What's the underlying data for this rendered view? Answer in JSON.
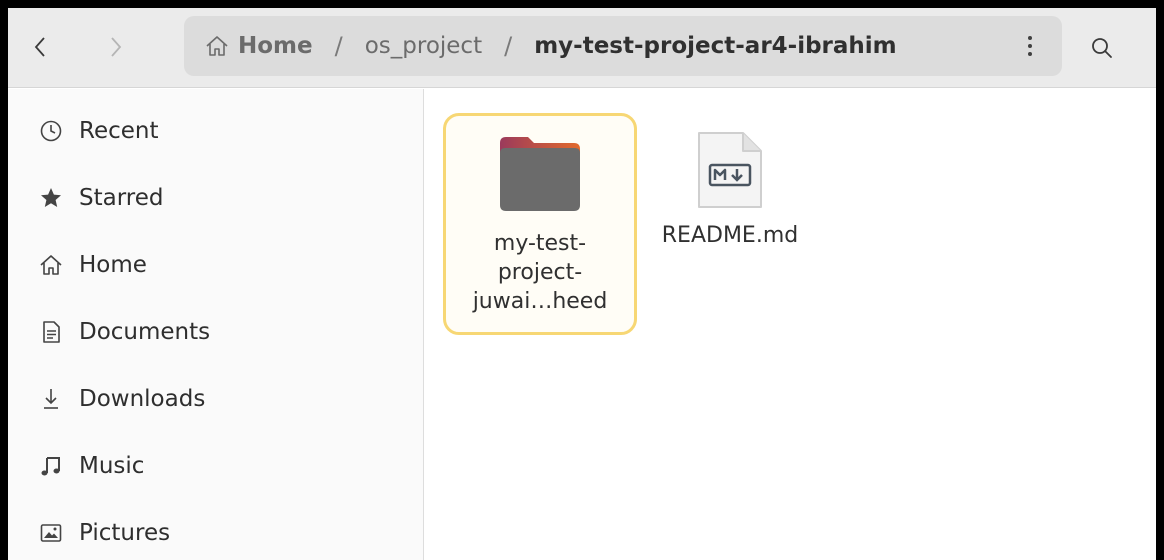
{
  "window": {
    "nav": {
      "back": "back",
      "forward": "forward"
    },
    "path": {
      "home": "Home",
      "parent": "os_project",
      "current": "my-test-project-ar4-ibrahim",
      "separator": "/"
    }
  },
  "sidebar": {
    "items": [
      {
        "label": "Recent",
        "icon": "clock-icon"
      },
      {
        "label": "Starred",
        "icon": "star-icon"
      },
      {
        "label": "Home",
        "icon": "home-icon"
      },
      {
        "label": "Documents",
        "icon": "document-icon"
      },
      {
        "label": "Downloads",
        "icon": "download-icon"
      },
      {
        "label": "Music",
        "icon": "music-note-icon"
      },
      {
        "label": "Pictures",
        "icon": "picture-icon"
      }
    ]
  },
  "files": [
    {
      "line1": "my-test-",
      "line2": "project-",
      "line3": "juwai…heed",
      "type": "folder",
      "selected": true
    },
    {
      "name": "README.md",
      "type": "markdown"
    }
  ],
  "colors": {
    "selection_border": "#f7d774",
    "folder_body": "#6b6b6b",
    "folder_tab_gradient_start": "#9b3a5c",
    "folder_tab_gradient_end": "#e26a2c"
  }
}
